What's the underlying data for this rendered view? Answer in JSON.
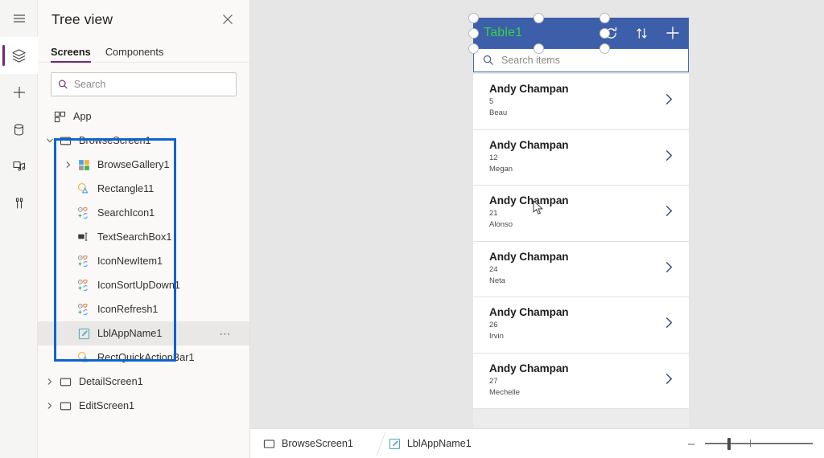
{
  "rail": {
    "items": [
      {
        "name": "menu-icon",
        "label": "Menu",
        "active": false
      },
      {
        "name": "tree-view-icon",
        "label": "Tree view",
        "active": true
      },
      {
        "name": "insert-icon",
        "label": "Insert",
        "active": false
      },
      {
        "name": "data-icon",
        "label": "Data",
        "active": false
      },
      {
        "name": "media-icon",
        "label": "Media",
        "active": false
      },
      {
        "name": "advanced-tools-icon",
        "label": "Advanced tools",
        "active": false
      }
    ]
  },
  "tree": {
    "title": "Tree view",
    "close_label": "✕",
    "tabs": [
      {
        "label": "Screens",
        "active": true
      },
      {
        "label": "Components",
        "active": false
      }
    ],
    "search": {
      "value": "",
      "placeholder": "Search"
    },
    "app_node": {
      "label": "App"
    },
    "nodes": [
      {
        "label": "BrowseScreen1",
        "level": 1,
        "expanded": true,
        "icon": "screen-icon",
        "highlighted": false,
        "selected": false
      },
      {
        "label": "BrowseGallery1",
        "level": 2,
        "expanded": false,
        "icon": "gallery-icon",
        "highlighted": true,
        "selected": false
      },
      {
        "label": "Rectangle11",
        "level": 2,
        "expanded": null,
        "icon": "shape-icon",
        "highlighted": true,
        "selected": false
      },
      {
        "label": "SearchIcon1",
        "level": 2,
        "expanded": null,
        "icon": "icons-icon",
        "highlighted": true,
        "selected": false
      },
      {
        "label": "TextSearchBox1",
        "level": 2,
        "expanded": null,
        "icon": "textinput-icon",
        "highlighted": true,
        "selected": false
      },
      {
        "label": "IconNewItem1",
        "level": 2,
        "expanded": null,
        "icon": "icons-icon",
        "highlighted": true,
        "selected": false
      },
      {
        "label": "IconSortUpDown1",
        "level": 2,
        "expanded": null,
        "icon": "icons-icon",
        "highlighted": true,
        "selected": false
      },
      {
        "label": "IconRefresh1",
        "level": 2,
        "expanded": null,
        "icon": "icons-icon",
        "highlighted": true,
        "selected": false
      },
      {
        "label": "LblAppName1",
        "level": 2,
        "expanded": null,
        "icon": "label-icon",
        "highlighted": true,
        "selected": true,
        "overflow": "⋯"
      },
      {
        "label": "RectQuickActionBar1",
        "level": 2,
        "expanded": null,
        "icon": "shape-icon",
        "highlighted": true,
        "selected": false
      },
      {
        "label": "DetailScreen1",
        "level": 1,
        "expanded": false,
        "icon": "screen-icon",
        "highlighted": false,
        "selected": false
      },
      {
        "label": "EditScreen1",
        "level": 1,
        "expanded": false,
        "icon": "screen-icon",
        "highlighted": false,
        "selected": false
      }
    ],
    "highlight_color": "#0f62d0"
  },
  "app_preview": {
    "header": {
      "title": "Table1",
      "title_color": "#35d24a",
      "background_color": "#3d5ea8",
      "icons": [
        {
          "name": "refresh-icon",
          "label": "Refresh"
        },
        {
          "name": "sort-updown-icon",
          "label": "Sort"
        },
        {
          "name": "new-item-icon",
          "label": "New item"
        }
      ]
    },
    "search": {
      "value": "",
      "placeholder": "Search items",
      "icon": "search-icon"
    },
    "gallery_items": [
      {
        "title": "Andy Champan",
        "line2": "5",
        "line3": "Beau"
      },
      {
        "title": "Andy Champan",
        "line2": "12",
        "line3": "Megan"
      },
      {
        "title": "Andy Champan",
        "line2": "21",
        "line3": "Alonso"
      },
      {
        "title": "Andy Champan",
        "line2": "24",
        "line3": "Neta"
      },
      {
        "title": "Andy Champan",
        "line2": "26",
        "line3": "Irvin"
      },
      {
        "title": "Andy Champan",
        "line2": "27",
        "line3": "Mechelle"
      }
    ],
    "selection": {
      "target": "LblAppName1",
      "handle_count": 8
    }
  },
  "statusbar": {
    "breadcrumb": [
      {
        "label": "BrowseScreen1",
        "icon": "screen-icon"
      },
      {
        "label": "LblAppName1",
        "icon": "label-icon"
      }
    ],
    "zoom": {
      "minus_label": "–",
      "value": 21
    }
  }
}
